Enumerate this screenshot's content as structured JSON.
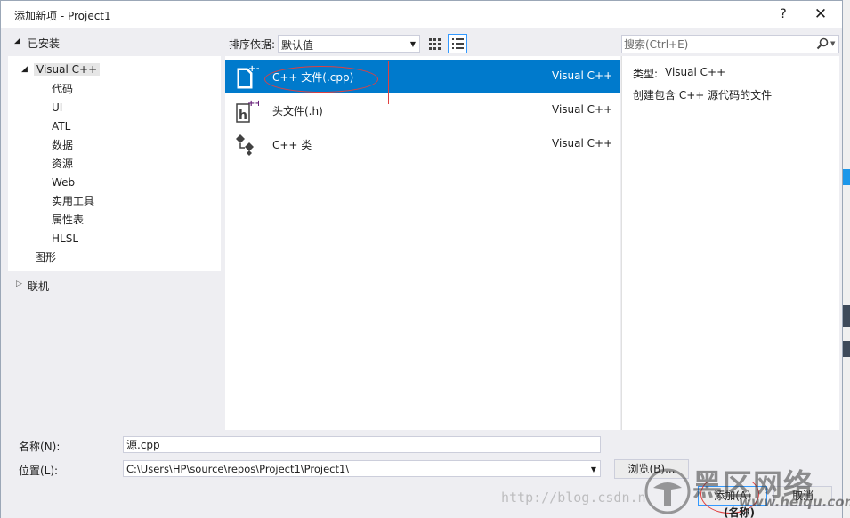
{
  "window": {
    "title": "添加新项 - Project1",
    "help_label": "?",
    "close_label": "✕"
  },
  "left_panel": {
    "installed_label": "已安装",
    "tree": {
      "root_label": "Visual C++",
      "children": [
        "代码",
        "UI",
        "ATL",
        "数据",
        "资源",
        "Web",
        "实用工具",
        "属性表",
        "HLSL"
      ],
      "graphics_label": "图形"
    },
    "online_label": "联机"
  },
  "toolbar": {
    "sort_label": "排序依据:",
    "sort_value": "默认值",
    "view_grid_icon": "grid-view-icon",
    "view_list_icon": "list-view-icon"
  },
  "templates": [
    {
      "name": "C++ 文件(.cpp)",
      "language": "Visual C++",
      "icon": "cpp-file-icon",
      "selected": true
    },
    {
      "name": "头文件(.h)",
      "language": "Visual C++",
      "icon": "header-file-icon",
      "selected": false
    },
    {
      "name": "C++ 类",
      "language": "Visual C++",
      "icon": "cpp-class-icon",
      "selected": false
    }
  ],
  "search": {
    "placeholder": "搜索(Ctrl+E)",
    "icon": "search-icon"
  },
  "details": {
    "type_label": "类型:",
    "type_value": "Visual C++",
    "description": "创建包含 C++ 源代码的文件"
  },
  "form": {
    "name_label": "名称(N):",
    "name_value": "源.cpp",
    "location_label": "位置(L):",
    "location_value": "C:\\Users\\HP\\source\\repos\\Project1\\Project1\\"
  },
  "buttons": {
    "browse": "浏览(B)...",
    "add": "添加(A)",
    "cancel": "取消"
  },
  "colors": {
    "selection": "#007acc",
    "accent": "#3399ff",
    "annotation": "#e04040"
  },
  "watermark": {
    "url": "http://blog.csdn.n",
    "brand": "黑区网络",
    "domain": "www.heiqu.com",
    "bg_text": "(名称)"
  }
}
